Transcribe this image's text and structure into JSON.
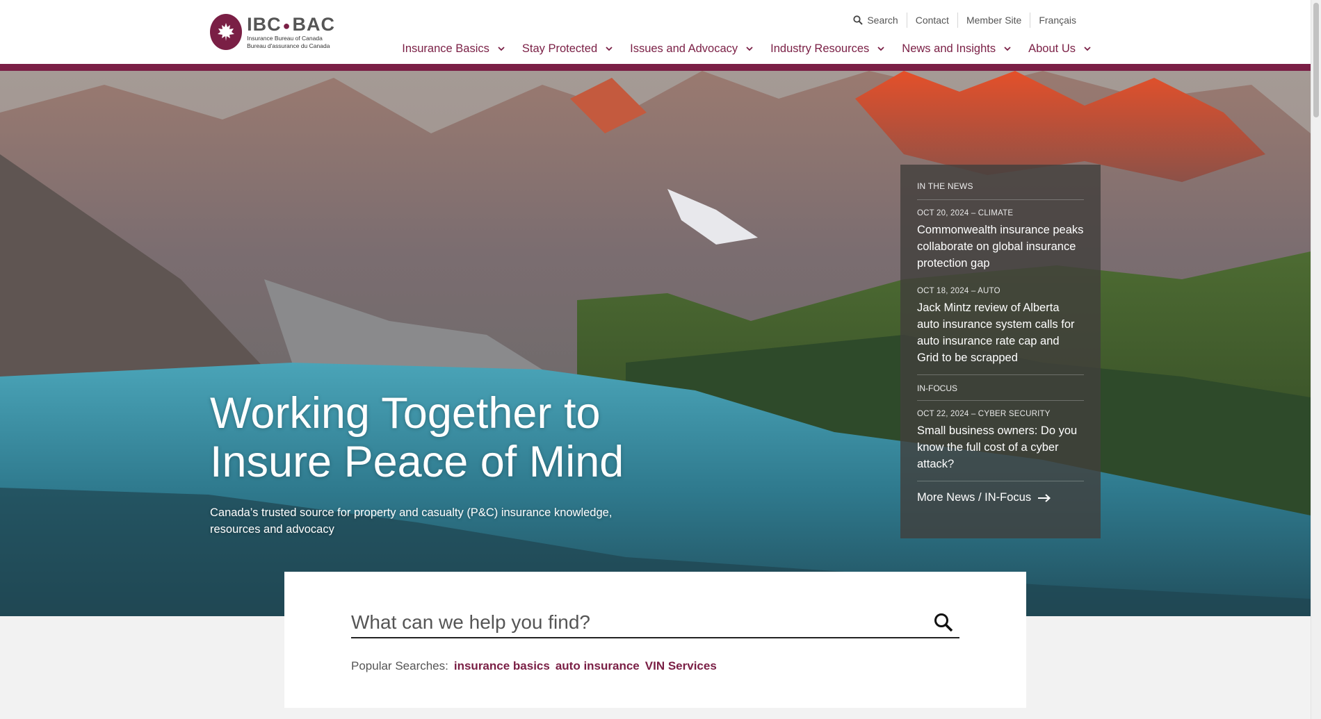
{
  "brand": {
    "logo_text": "IBC",
    "logo_text_2": "BAC",
    "tagline_en": "Insurance Bureau of Canada",
    "tagline_fr": "Bureau d'assurance du Canada"
  },
  "utility_nav": {
    "search_label": "Search",
    "contact_label": "Contact",
    "member_label": "Member Site",
    "lang_label": "Français"
  },
  "main_nav": [
    {
      "label": "Insurance Basics"
    },
    {
      "label": "Stay Protected"
    },
    {
      "label": "Issues and Advocacy"
    },
    {
      "label": "Industry Resources"
    },
    {
      "label": "News and Insights"
    },
    {
      "label": "About Us"
    }
  ],
  "hero": {
    "title": "Working Together to Insure Peace of Mind",
    "subtitle": "Canada’s trusted source for property and casualty (P&C) insurance knowledge, resources and advocacy"
  },
  "news_panel": {
    "section_label": "IN THE NEWS",
    "items": [
      {
        "meta": "OCT 20, 2024 – CLIMATE",
        "headline": "Commonwealth insurance peaks collaborate on global insurance protection gap"
      },
      {
        "meta": "OCT 18, 2024 – AUTO",
        "headline": "Jack Mintz review of Alberta auto insurance system calls for auto insurance rate cap and Grid to be scrapped"
      }
    ],
    "infocus_label": "IN-FOCUS",
    "infocus_item": {
      "meta": "OCT 22, 2024 – CYBER SECURITY",
      "headline": "Small business owners: Do you know the full cost of a cyber attack?"
    },
    "more_label": "More News / IN-Focus"
  },
  "search": {
    "placeholder": "What can we help you find?",
    "popular_label": "Popular Searches:",
    "popular": [
      "insurance basics",
      "auto insurance",
      "VIN Services"
    ]
  },
  "colors": {
    "brand": "#7a1f45",
    "white": "#ffffff",
    "page_bg": "#f2f2f2"
  }
}
